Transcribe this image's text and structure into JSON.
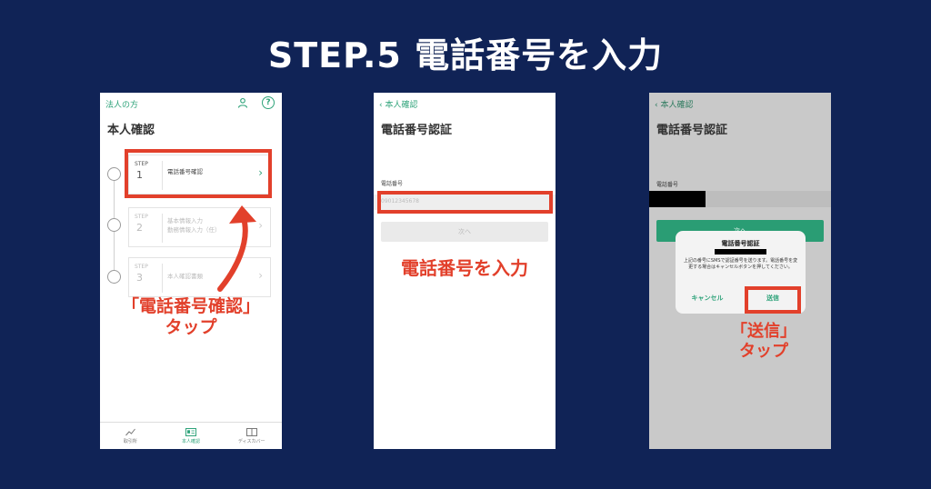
{
  "page": {
    "title": "STEP.5 電話番号を入力"
  },
  "screen1": {
    "top_label": "法人の方",
    "title": "本人確認",
    "steps": [
      {
        "step": "STEP",
        "num": "1",
        "text_lines": [
          "電話番号確認"
        ]
      },
      {
        "step": "STEP",
        "num": "2",
        "text_lines": [
          "基本情報入力",
          "勤務情報入力（任）"
        ]
      },
      {
        "step": "STEP",
        "num": "3",
        "text_lines": [
          "本人確認書類"
        ]
      }
    ],
    "chevron": "›",
    "annotation": {
      "line1": "「電話番号確認」",
      "line2": "タップ"
    },
    "tabs": [
      {
        "label": "取引所",
        "icon": "chart-icon"
      },
      {
        "label": "本人確認",
        "icon": "id-card-icon"
      },
      {
        "label": "ディスカバー",
        "icon": "book-icon"
      }
    ],
    "colors": {
      "accent": "#2fa37a",
      "highlight": "#e2402b"
    }
  },
  "screen2": {
    "back_label": "本人確認",
    "title": "電話番号認証",
    "field_label": "電話番号",
    "field_placeholder": "09012345678",
    "next_label": "次へ",
    "annotation": "電話番号を入力"
  },
  "screen3": {
    "back_label": "本人確認",
    "title": "電話番号認証",
    "field_label": "電話番号",
    "button_label": "次へ",
    "dialog": {
      "title": "電話番号認証",
      "message": "上記の番号にSMSで認証番号を送ります。電話番号を変更する場合はキャンセルボタンを押してください。",
      "cancel_label": "キャンセル",
      "send_label": "送信"
    },
    "annotation": {
      "line1": "「送信」",
      "line2": "タップ"
    }
  }
}
